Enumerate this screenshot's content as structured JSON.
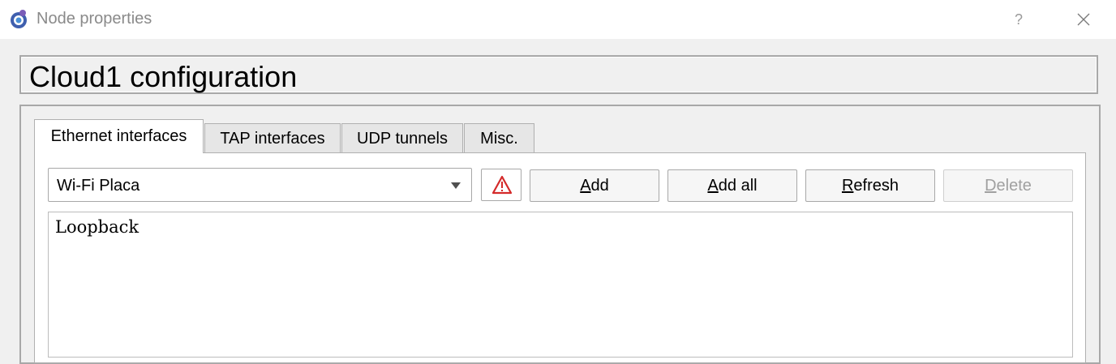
{
  "window": {
    "title": "Node properties",
    "help_glyph": "?",
    "icons": {
      "app": "gns3-app-icon",
      "close": "close-icon"
    }
  },
  "header": {
    "title": "Cloud1 configuration"
  },
  "tabs": [
    {
      "label": "Ethernet interfaces",
      "active": true
    },
    {
      "label": "TAP interfaces",
      "active": false
    },
    {
      "label": "UDP tunnels",
      "active": false
    },
    {
      "label": "Misc.",
      "active": false
    }
  ],
  "ethernet": {
    "interface_select": {
      "value": "Wi-Fi Placa"
    },
    "warning_icon": "warning-triangle-icon",
    "warning_color": "#d42a2a",
    "buttons": {
      "add": {
        "mnemonic": "A",
        "rest": "dd",
        "enabled": true
      },
      "add_all": {
        "mnemonic": "A",
        "rest": "dd all",
        "enabled": true
      },
      "refresh": {
        "mnemonic": "R",
        "rest": "efresh",
        "enabled": true
      },
      "delete": {
        "mnemonic": "D",
        "rest": "elete",
        "enabled": false
      }
    },
    "interfaces": [
      "Loopback"
    ]
  }
}
